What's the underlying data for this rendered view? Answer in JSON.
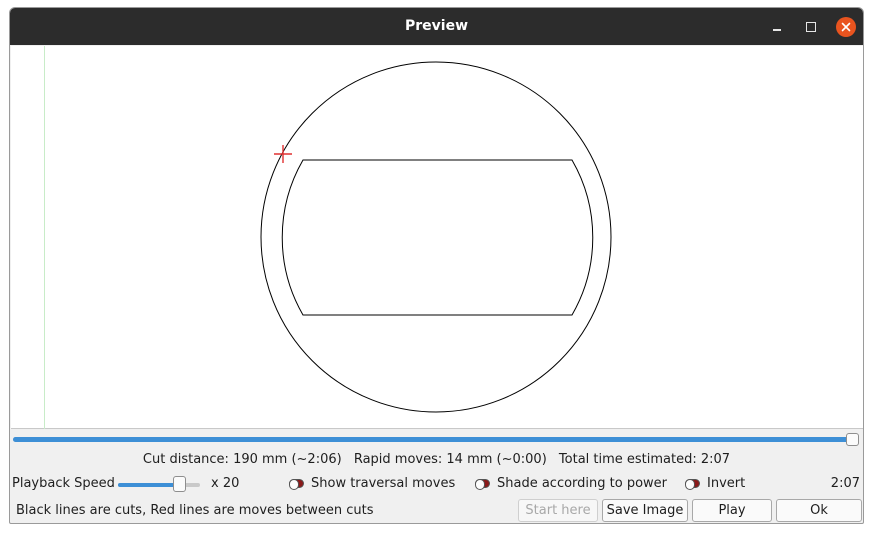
{
  "window": {
    "title": "Preview"
  },
  "stats": {
    "cut_distance": "Cut distance: 190 mm (~2:06)",
    "rapid_moves": "Rapid moves: 14 mm (~0:00)",
    "total_time": "Total time estimated: 2:07"
  },
  "playback": {
    "progress": 1.0,
    "speed_label": "Playback Speed",
    "speed_level": 0.8,
    "speed_multiplier": "x 20",
    "elapsed_time": "2:07"
  },
  "options": {
    "show_traversal_moves": "Show traversal moves",
    "shade_according_to_power": "Shade according to power",
    "invert": "Invert"
  },
  "hint": "Black lines are cuts, Red lines are moves between cuts",
  "buttons": {
    "start_here": "Start here",
    "save_image": "Save Image",
    "play": "Play",
    "ok": "Ok"
  },
  "colors": {
    "cut_line": "#000000",
    "traversal_line": "#e03030",
    "accent": "#3d8fd6",
    "titlebar": "#2c2c2c",
    "close_button": "#e9541f"
  }
}
